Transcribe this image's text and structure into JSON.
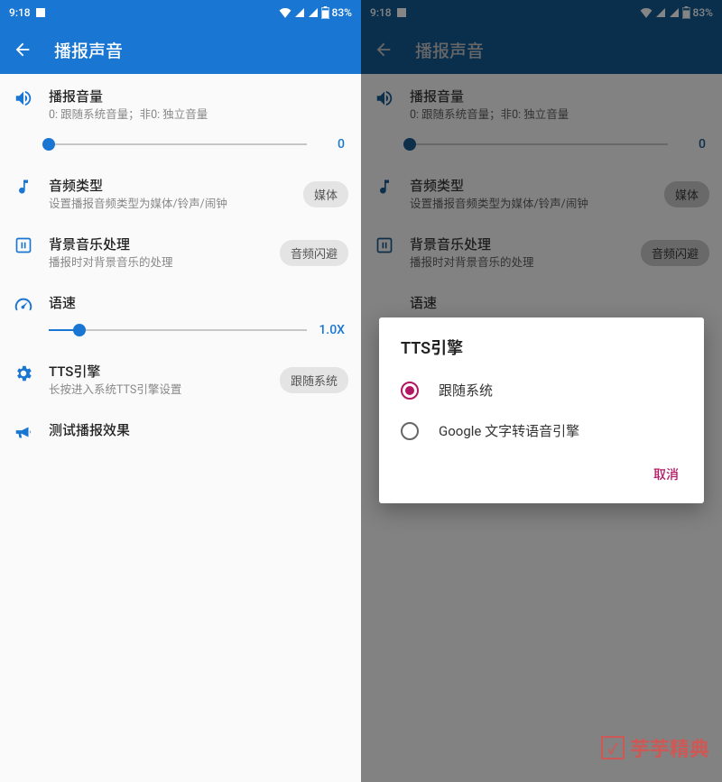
{
  "status": {
    "time": "9:18",
    "battery": "83%"
  },
  "appbar": {
    "title": "播报声音"
  },
  "items": {
    "volume": {
      "title": "播报音量",
      "sub": "0: 跟随系统音量；非0: 独立音量",
      "value": "0"
    },
    "audiotype": {
      "title": "音频类型",
      "sub": "设置播报音频类型为媒体/铃声/闹钟",
      "badge": "媒体"
    },
    "bgmusic": {
      "title": "背景音乐处理",
      "sub": "播报时对背景音乐的处理",
      "badge": "音频闪避"
    },
    "speed": {
      "title": "语速",
      "value": "1.0X"
    },
    "tts": {
      "title": "TTS引擎",
      "sub": "长按进入系统TTS引擎设置",
      "badge": "跟随系统"
    },
    "test": {
      "title": "测试播报效果"
    }
  },
  "dialog": {
    "title": "TTS引擎",
    "options": {
      "opt0": "跟随系统",
      "opt1": "Google 文字转语音引擎"
    },
    "cancel": "取消"
  },
  "watermark": "芋芋精典"
}
